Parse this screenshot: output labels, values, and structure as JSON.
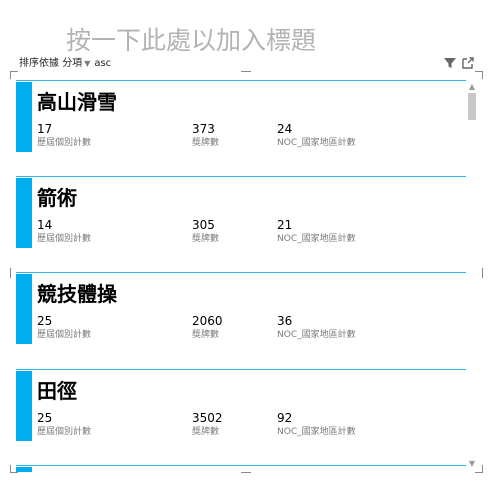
{
  "title": "按一下此處以加入標題",
  "sort": {
    "label": "排序依據",
    "field": "分項",
    "order": "asc"
  },
  "icons": {
    "filter": "filter-icon",
    "popout": "popout-icon",
    "scroll_up": "scroll-up-arrow",
    "scroll_down": "scroll-down-arrow"
  },
  "colors": {
    "accent": "#00adef",
    "card_line": "#2db8e6",
    "title": "#b3b3b3",
    "label": "#7b7b7b"
  },
  "cards": [
    {
      "name": "高山滑雪",
      "v1": "17",
      "l1": "歷屆個別計數",
      "v2": "373",
      "l2": "獎牌數",
      "v3": "24",
      "l3": "NOC_國家地區計數"
    },
    {
      "name": "箭術",
      "v1": "14",
      "l1": "歷屆個別計數",
      "v2": "305",
      "l2": "獎牌數",
      "v3": "21",
      "l3": "NOC_國家地區計數"
    },
    {
      "name": "競技體操",
      "v1": "25",
      "l1": "歷屆個別計數",
      "v2": "2060",
      "l2": "獎牌數",
      "v3": "36",
      "l3": "NOC_國家地區計數"
    },
    {
      "name": "田徑",
      "v1": "25",
      "l1": "歷屆個別計數",
      "v2": "3502",
      "l2": "獎牌數",
      "v3": "92",
      "l3": "NOC_國家地區計數"
    }
  ]
}
